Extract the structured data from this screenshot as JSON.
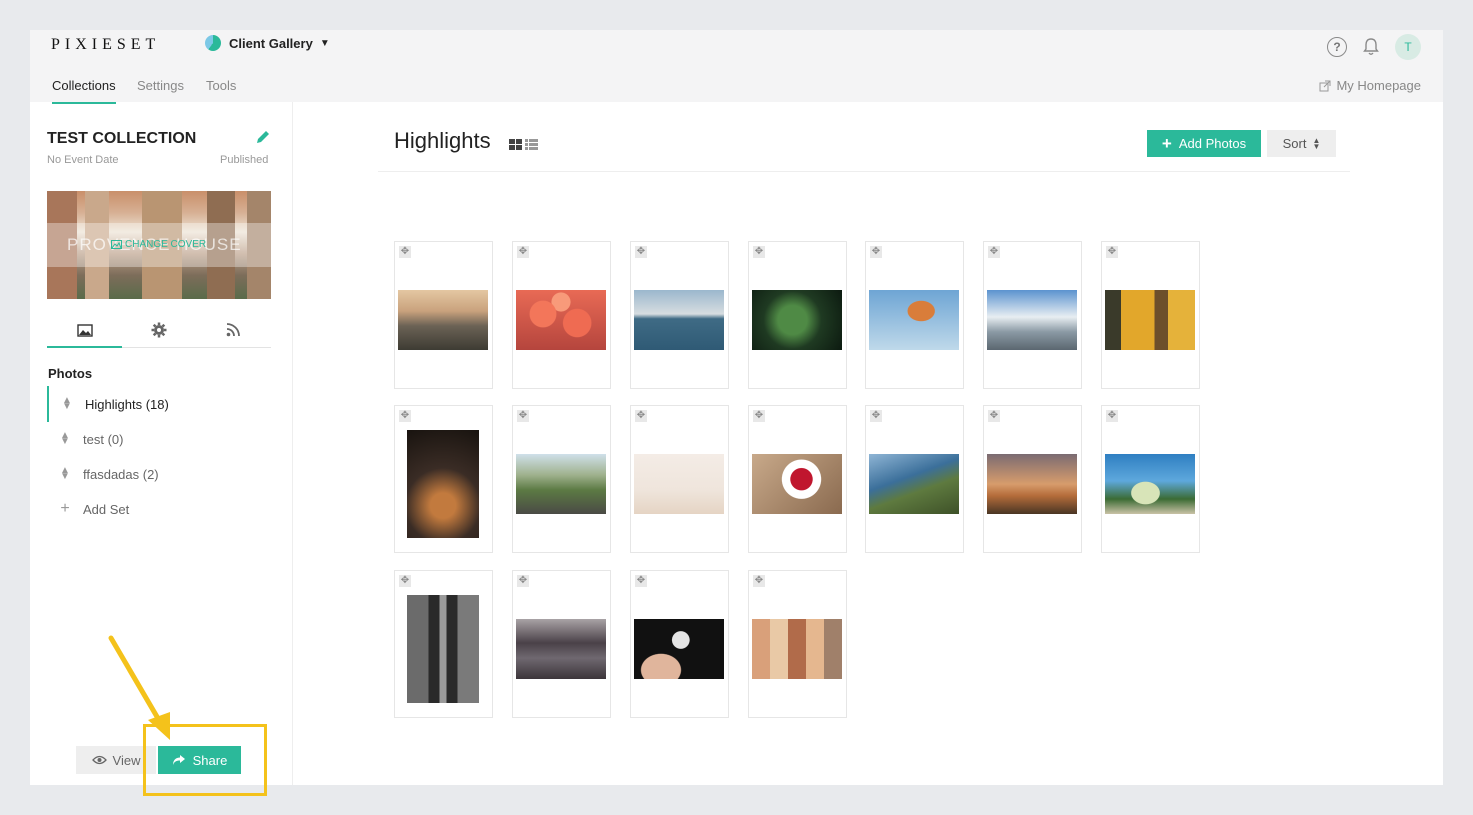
{
  "brand": {
    "logo": "PIXIESET",
    "accent": "#2bb99a",
    "callout_color": "#f4c21b"
  },
  "header": {
    "gallery_name": "Client Gallery",
    "icons": [
      "help-circle-icon",
      "bell-icon"
    ],
    "avatar_initial": "T"
  },
  "nav": {
    "tabs": [
      {
        "label": "Collections",
        "active": true
      },
      {
        "label": "Settings",
        "active": false
      },
      {
        "label": "Tools",
        "active": false
      }
    ],
    "homepage_label": "My Homepage"
  },
  "sidebar": {
    "collection_title": "TEST COLLECTION",
    "event_date": "No Event Date",
    "status": "Published",
    "cover_ghost_text": "PROVENCE HOUSE",
    "change_cover_label": "CHANGE COVER",
    "section_label": "Photos",
    "sets": [
      {
        "label": "Highlights (18)",
        "active": true
      },
      {
        "label": "test (0)",
        "active": false
      },
      {
        "label": "ffasdadas (2)",
        "active": false
      }
    ],
    "add_set_label": "Add Set",
    "view_label": "View",
    "share_label": "Share"
  },
  "main": {
    "title": "Highlights",
    "add_photos_label": "Add Photos",
    "sort_label": "Sort",
    "photos": [
      {
        "subject": "misty mountain cliff at sunset",
        "orientation": "landscape"
      },
      {
        "subject": "pink flowers",
        "orientation": "landscape"
      },
      {
        "subject": "calm sea horizon",
        "orientation": "landscape"
      },
      {
        "subject": "green leaves",
        "orientation": "landscape"
      },
      {
        "subject": "hot air balloon",
        "orientation": "landscape"
      },
      {
        "subject": "city skyline with clouds",
        "orientation": "landscape"
      },
      {
        "subject": "yellow storefront with bicycle",
        "orientation": "landscape"
      },
      {
        "subject": "string lights alley at night",
        "orientation": "portrait"
      },
      {
        "subject": "winding mountain road",
        "orientation": "landscape"
      },
      {
        "subject": "palm trees on beach",
        "orientation": "landscape"
      },
      {
        "subject": "raspberries in white cup",
        "orientation": "landscape"
      },
      {
        "subject": "coastal cliffs",
        "orientation": "landscape"
      },
      {
        "subject": "sunset over field",
        "orientation": "landscape"
      },
      {
        "subject": "vintage van under palm trees",
        "orientation": "landscape"
      },
      {
        "subject": "aerial city street black and white",
        "orientation": "portrait"
      },
      {
        "subject": "foggy forest lake",
        "orientation": "landscape"
      },
      {
        "subject": "hand holding dandelion",
        "orientation": "landscape"
      },
      {
        "subject": "colorful old buildings",
        "orientation": "landscape"
      }
    ]
  }
}
